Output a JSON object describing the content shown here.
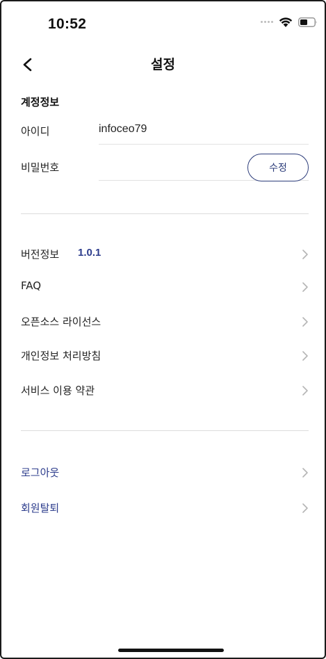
{
  "status_bar": {
    "time": "10:52"
  },
  "header": {
    "title": "설정",
    "back_icon": "chevron-left-icon"
  },
  "account": {
    "section_title": "계정정보",
    "id_label": "아이디",
    "id_value": "infoceo79",
    "password_label": "비밀번호",
    "edit_button_label": "수정"
  },
  "menu": {
    "items": [
      {
        "label": "버전정보",
        "value": "1.0.1"
      },
      {
        "label": "FAQ"
      },
      {
        "label": "오픈소스 라이선스"
      },
      {
        "label": "개인정보 처리방침"
      },
      {
        "label": "서비스 이용 약관"
      }
    ]
  },
  "account_actions": {
    "items": [
      {
        "label": "로그아웃"
      },
      {
        "label": "회원탈퇴"
      }
    ]
  },
  "colors": {
    "accent": "#2c3c8c",
    "divider": "#dcdcdc",
    "chevron": "#b5b5b5"
  }
}
